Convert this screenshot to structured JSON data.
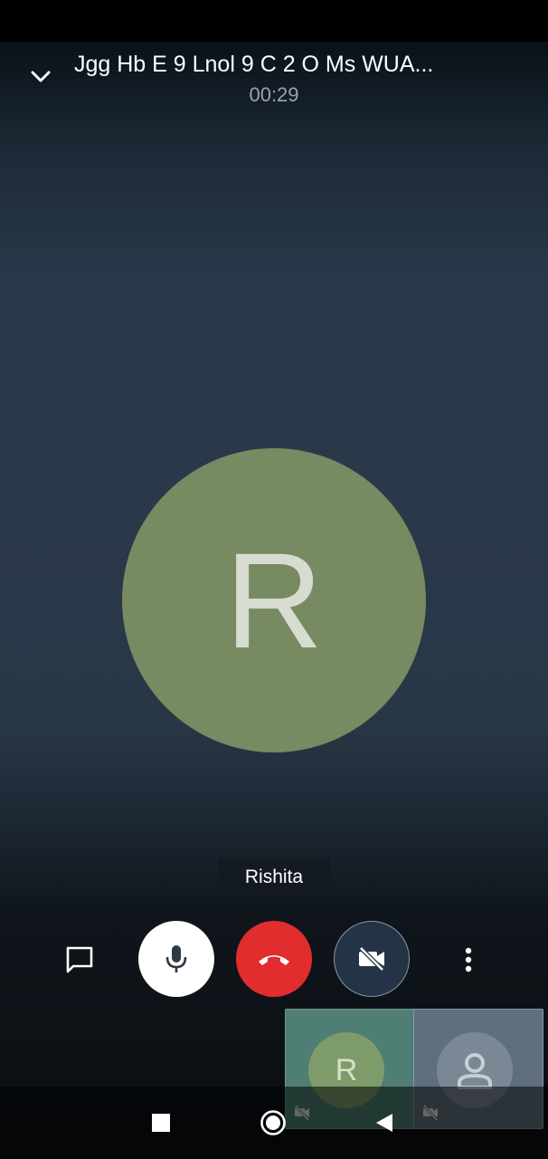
{
  "call": {
    "title": "Jgg Hb E 9 Lnol 9 C 2 O Ms WUA...",
    "duration": "00:29"
  },
  "main_participant": {
    "initial": "R",
    "name": "Rishita",
    "avatar_color": "#788a62"
  },
  "controls": {
    "chat_icon": "chat-bubble-icon",
    "mic_icon": "microphone-icon",
    "end_call_icon": "end-call-icon",
    "video_off_icon": "video-off-icon",
    "more_icon": "more-vertical-icon",
    "end_call_color": "#e12d2d"
  },
  "thumbnails": [
    {
      "initial": "R",
      "tile_color": "#4e7e74",
      "avatar_color": "#7e9c6a",
      "camera": "off"
    },
    {
      "initial": "",
      "tile_color": "#5f6f7d",
      "avatar_color": "#7a8895",
      "camera": "off"
    }
  ],
  "nav": {
    "recents_icon": "square-icon",
    "home_icon": "circle-icon",
    "back_icon": "triangle-back-icon"
  }
}
